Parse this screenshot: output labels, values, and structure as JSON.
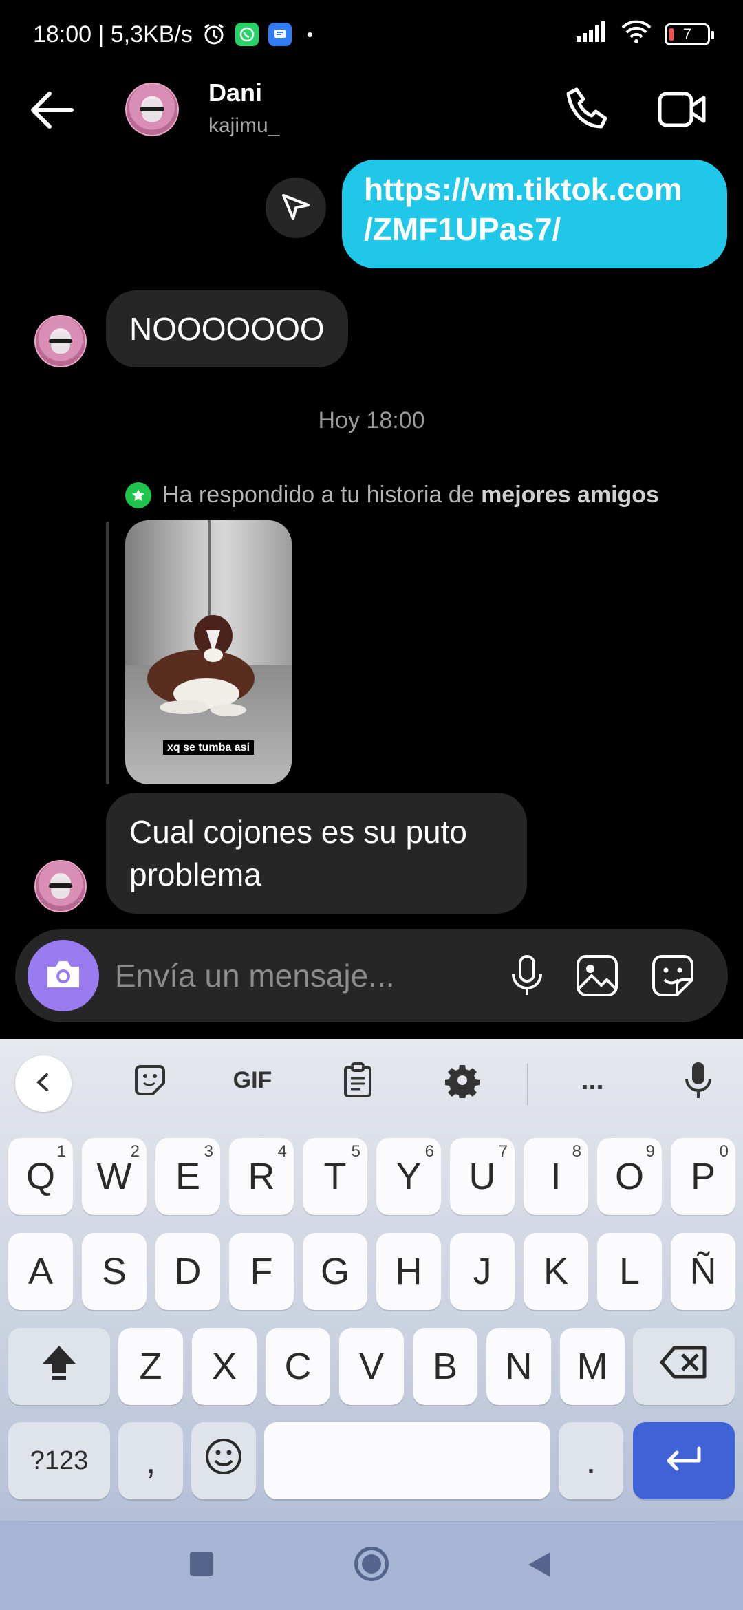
{
  "status_bar": {
    "time_speed": "18:00 | 5,3KB/s",
    "dot": "•",
    "battery": "7"
  },
  "header": {
    "name": "Dani",
    "username": "kajimu_"
  },
  "messages": {
    "sent_link": "https://vm.tiktok.com\n/ZMF1UPas7/",
    "received_1": "NOOOOOOO",
    "timestamp": "Hoy 18:00",
    "reply_note_prefix": "Ha respondido a tu historia de ",
    "reply_note_bold": "mejores amigos",
    "story_caption": "xq se tumba asi",
    "received_2": "Cual cojones es su puto problema"
  },
  "composer": {
    "placeholder": "Envía un mensaje..."
  },
  "keyboard": {
    "gif_label": "GIF",
    "more_label": "...",
    "row1": [
      {
        "k": "Q",
        "n": "1"
      },
      {
        "k": "W",
        "n": "2"
      },
      {
        "k": "E",
        "n": "3"
      },
      {
        "k": "R",
        "n": "4"
      },
      {
        "k": "T",
        "n": "5"
      },
      {
        "k": "Y",
        "n": "6"
      },
      {
        "k": "U",
        "n": "7"
      },
      {
        "k": "I",
        "n": "8"
      },
      {
        "k": "O",
        "n": "9"
      },
      {
        "k": "P",
        "n": "0"
      }
    ],
    "row2": [
      "A",
      "S",
      "D",
      "F",
      "G",
      "H",
      "J",
      "K",
      "L",
      "Ñ"
    ],
    "row3": [
      "Z",
      "X",
      "C",
      "V",
      "B",
      "N",
      "M"
    ],
    "symbols_label": "?123",
    "comma_label": ",",
    "period_label": "."
  },
  "icons": {
    "alarm": "alarm-icon",
    "whatsapp": "whatsapp-icon",
    "messages": "messages-app-icon",
    "signal": "signal-icon",
    "wifi": "wifi-icon",
    "battery": "battery-icon",
    "back": "back-arrow-icon",
    "call": "phone-icon",
    "video": "video-call-icon",
    "share": "send-icon",
    "camera": "camera-icon",
    "mic": "microphone-icon",
    "gallery": "gallery-icon",
    "sticker": "sticker-icon"
  },
  "colors": {
    "outgoing_bubble": "#1fc7e8",
    "incoming_bubble": "#262626",
    "camera_button": "#9b7cf0",
    "best_friends_badge": "#1ec44b",
    "enter_key": "#3f63d6"
  }
}
